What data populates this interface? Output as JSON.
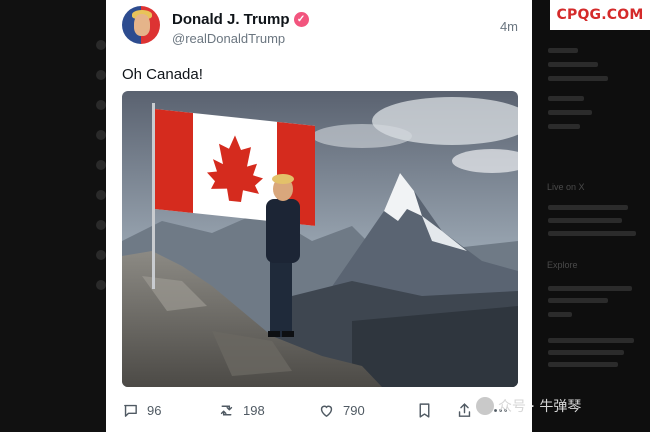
{
  "watermark": {
    "site": "CPQG.COM",
    "wechat": "众号 · 牛弹琴"
  },
  "tweet": {
    "author_name": "Donald J. Trump",
    "author_handle": "@realDonaldTrump",
    "time_ago": "4m",
    "text": "Oh Canada!"
  },
  "stats": {
    "replies": "96",
    "reposts": "198",
    "likes": "790"
  },
  "sidebar_right": {
    "section1": "Live on X",
    "section2": "Explore"
  },
  "icons": [
    "avatar",
    "verified-icon",
    "reply-icon",
    "repost-icon",
    "like-icon",
    "bookmark-icon",
    "share-icon",
    "more-icon"
  ]
}
